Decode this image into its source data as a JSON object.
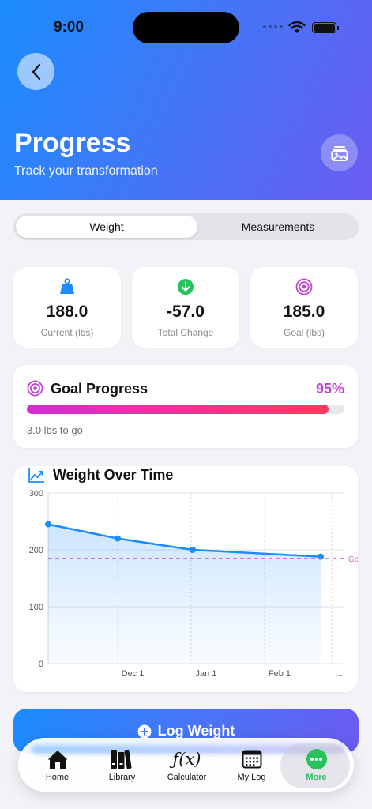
{
  "status_bar": {
    "time": "9:00"
  },
  "header": {
    "title": "Progress",
    "subtitle": "Track your transformation"
  },
  "tabs_segment": {
    "items": [
      "Weight",
      "Measurements"
    ],
    "selected": "Weight"
  },
  "stats": [
    {
      "value": "188.0",
      "label": "Current (lbs)",
      "icon": "weight-icon",
      "color": "#1b8cff"
    },
    {
      "value": "-57.0",
      "label": "Total Change",
      "icon": "arrow-down-circle-icon",
      "color": "#27c25a"
    },
    {
      "value": "185.0",
      "label": "Goal (lbs)",
      "icon": "target-icon",
      "color": "#c43fd9"
    }
  ],
  "goal": {
    "title": "Goal Progress",
    "percent_label": "95%",
    "percent": 0.95,
    "remaining": "3.0 lbs to go"
  },
  "chart_data": {
    "type": "line",
    "title": "Weight Over Time",
    "x": [
      0,
      1,
      2,
      3
    ],
    "values": [
      245,
      220,
      200,
      188
    ],
    "x_ticks": [
      "Dec 1",
      "Jan 1",
      "Feb 1",
      "..."
    ],
    "y_ticks": [
      "300",
      "200",
      "100",
      "0"
    ],
    "ylim": [
      0,
      300
    ],
    "goal_value": 185,
    "goal_label": "Go",
    "grid": true,
    "line_color": "#1b8cff",
    "goal_color": "#d45fd0"
  },
  "log_button": {
    "label": "Log Weight"
  },
  "tabbar": {
    "items": [
      {
        "label": "Home",
        "icon": "house-icon"
      },
      {
        "label": "Library",
        "icon": "books-icon"
      },
      {
        "label": "Calculator",
        "icon": "function-icon",
        "glyph": "ƒ(x)"
      },
      {
        "label": "My Log",
        "icon": "calendar-icon"
      },
      {
        "label": "More",
        "icon": "more-icon"
      }
    ],
    "active": "More",
    "active_color": "#27c25a"
  }
}
